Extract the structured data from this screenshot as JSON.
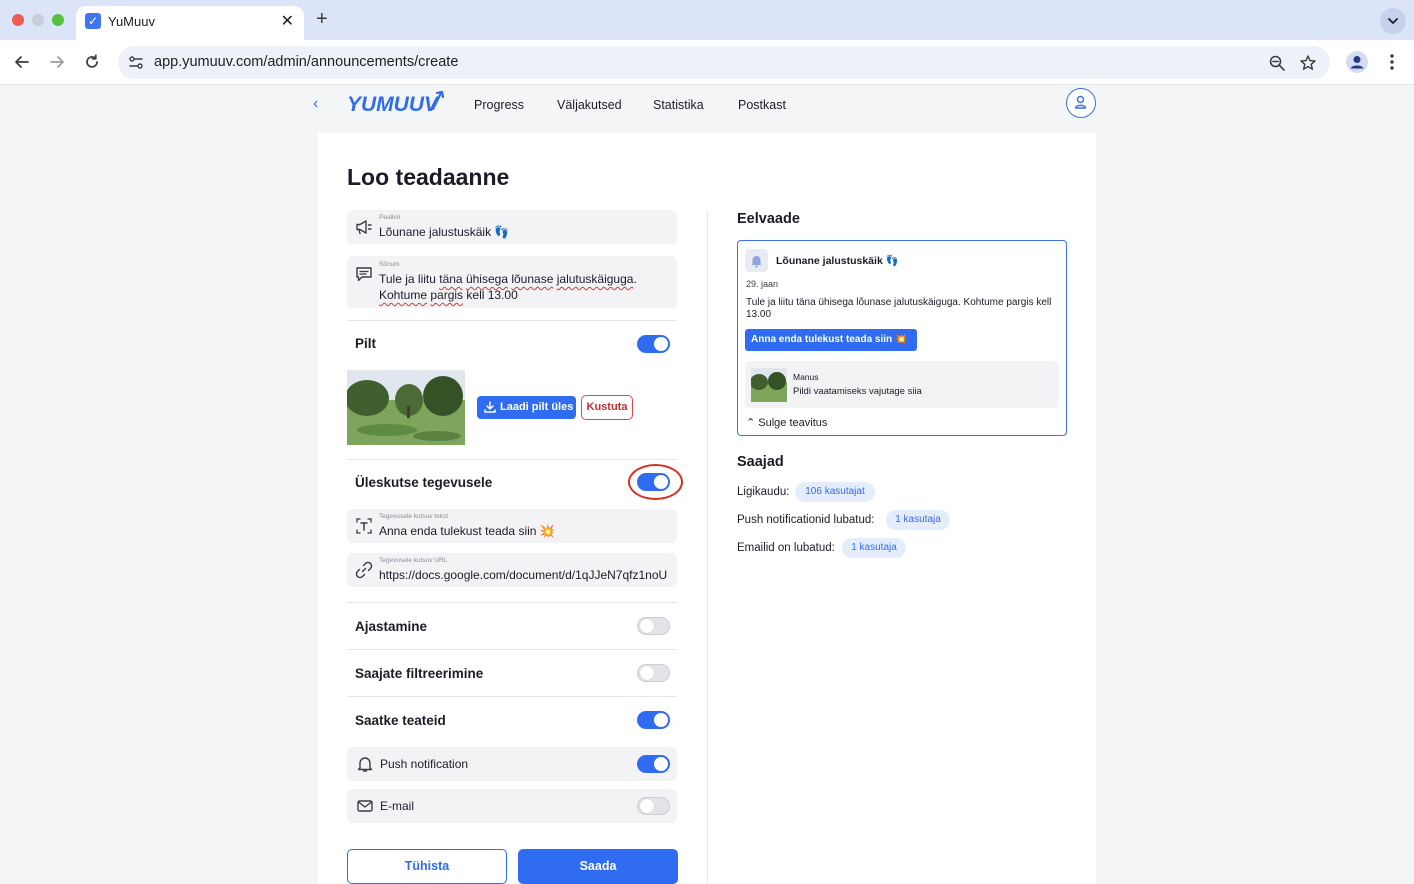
{
  "browser": {
    "tab_title": "YuMuuv",
    "tab_favicon": "✓",
    "url": "app.yumuuv.com/admin/announcements/create",
    "close_glyph": "✕",
    "new_tab_glyph": "+"
  },
  "header": {
    "logo_text": "YUMUUV",
    "back_glyph": "‹",
    "nav": [
      "Progress",
      "Väljakutsed",
      "Statistika",
      "Postkast"
    ]
  },
  "form": {
    "page_title": "Loo teadaanne",
    "title_field": {
      "label": "Pealkiri",
      "value": "Lõunane jalustuskäik 👣"
    },
    "message_field": {
      "label": "Sõnum",
      "line1_a": "Tule ja liitu ",
      "line1_b": "täna",
      "line1_c": " ",
      "line1_d": "ühisega",
      "line1_e": " ",
      "line1_f": "lõunase",
      "line1_g": " ",
      "line1_h": "jalutuskäiguga",
      "line1_i": ".",
      "line2_a": "Kohtume",
      "line2_b": " ",
      "line2_c": "pargis",
      "line2_d": " kell 13.00"
    },
    "image_section": {
      "label": "Pilt",
      "enabled": true,
      "upload_label": "Laadi pilt üles",
      "delete_label": "Kustuta"
    },
    "cta_section": {
      "label": "Üleskutse tegevusele",
      "enabled": true,
      "text_field": {
        "label": "Tegevusele kutsuv tekst",
        "value": "Anna enda tulekust teada siin 💥"
      },
      "url_field": {
        "label": "Tegevusele kutsuv URL",
        "value": "https://docs.google.com/document/d/1qJJeN7qfz1noU"
      }
    },
    "scheduling": {
      "label": "Ajastamine",
      "enabled": false
    },
    "filtering": {
      "label": "Saajate filtreerimine",
      "enabled": false
    },
    "send_notifications": {
      "label": "Saatke teateid",
      "enabled": true
    },
    "push": {
      "label": "Push notification",
      "enabled": true
    },
    "email": {
      "label": "E-mail",
      "enabled": false
    },
    "cancel_label": "Tühista",
    "send_label": "Saada"
  },
  "preview": {
    "heading": "Eelvaade",
    "title": "Lõunane jalustuskäik 👣",
    "date": "29. jaan",
    "message": "Tule ja liitu täna ühisega lõunase jalutuskäiguga. Kohtume pargis kell 13.00",
    "cta_label": "Anna enda tulekust teada siin 💥",
    "attachment_title": "Manus",
    "attachment_sub": "Pildi vaatamiseks vajutage siia",
    "close_label": "Sulge teavitus",
    "close_glyph": "⌃"
  },
  "recipients": {
    "heading": "Saajad",
    "rows": [
      {
        "label": "Ligikaudu:",
        "chip": "106 kasutajat"
      },
      {
        "label": "Push notificationid lubatud:",
        "chip": "1 kasutaja"
      },
      {
        "label": "Emailid on lubatud:",
        "chip": "1 kasutaja"
      }
    ]
  },
  "colors": {
    "accent": "#2f6cf2",
    "danger": "#c02f2f",
    "highlight_ring": "#d93025"
  }
}
